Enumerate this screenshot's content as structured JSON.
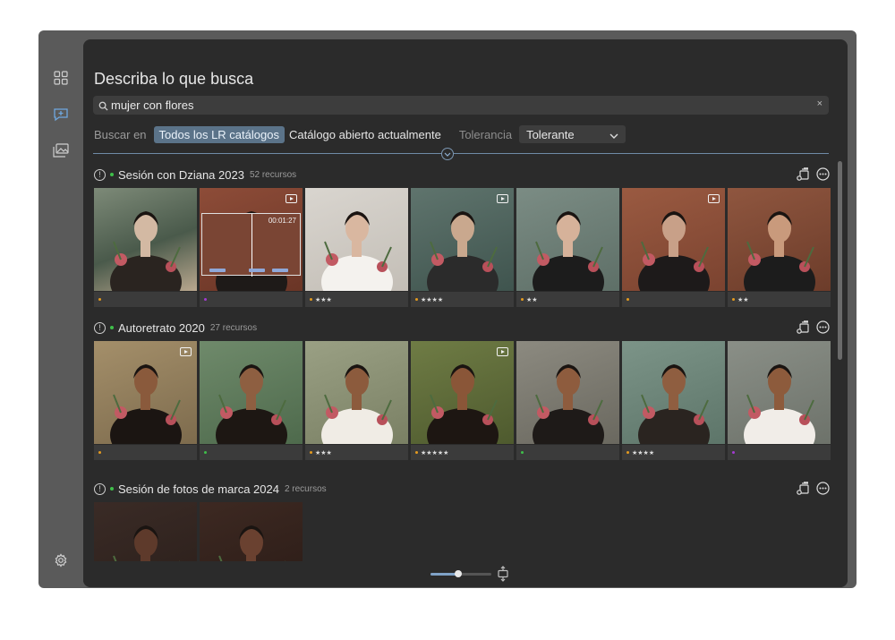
{
  "rail": {
    "items": [
      {
        "name": "grid-icon",
        "active": false
      },
      {
        "name": "search-chat-icon",
        "active": true
      },
      {
        "name": "photos-icon",
        "active": false
      }
    ],
    "settings_icon": "gear-icon"
  },
  "header": {
    "title": "Describa lo que busca"
  },
  "search": {
    "value": "mujer con flores",
    "placeholder": "",
    "clear_label": "×"
  },
  "scope": {
    "label": "Buscar en",
    "selected_option": "Todos los LR catálogos",
    "other_option": "Catálogo abierto actualmente",
    "tolerance_label": "Tolerancia",
    "tolerance_value": "Tolerante"
  },
  "colors": {
    "accent": "#5b7389",
    "divider": "#6f8aa6",
    "green": "#3fbf4a",
    "orange": "#e39a1f",
    "purple": "#a33bd1"
  },
  "sections": [
    {
      "name": "Sesión con Dziana 2023",
      "count": "52 recursos",
      "tiles": [
        {
          "dot": "orange",
          "stars": ""
        },
        {
          "dot": "purple",
          "stars": "",
          "video": true,
          "hover_duration": "00:01:27"
        },
        {
          "dot": "orange",
          "stars": "★★★"
        },
        {
          "dot": "orange",
          "stars": "★★★★",
          "video": true
        },
        {
          "dot": "orange",
          "stars": "★★"
        },
        {
          "dot": "orange",
          "stars": "",
          "video": true
        },
        {
          "dot": "orange",
          "stars": "★★"
        }
      ]
    },
    {
      "name": "Autoretrato 2020",
      "count": "27 recursos",
      "tiles": [
        {
          "dot": "orange",
          "stars": "",
          "video": true
        },
        {
          "dot": "green",
          "stars": ""
        },
        {
          "dot": "orange",
          "stars": "★★★"
        },
        {
          "dot": "orange",
          "stars": "★★★★★",
          "video": true
        },
        {
          "dot": "green",
          "stars": ""
        },
        {
          "dot": "orange",
          "stars": "★★★★"
        },
        {
          "dot": "purple",
          "stars": ""
        }
      ]
    },
    {
      "name": "Sesión de fotos de marca 2024",
      "count": "2 recursos",
      "tiles": [
        {
          "dot": "",
          "stars": ""
        },
        {
          "dot": "",
          "stars": ""
        }
      ]
    }
  ],
  "thumbnail_size": 0.45
}
